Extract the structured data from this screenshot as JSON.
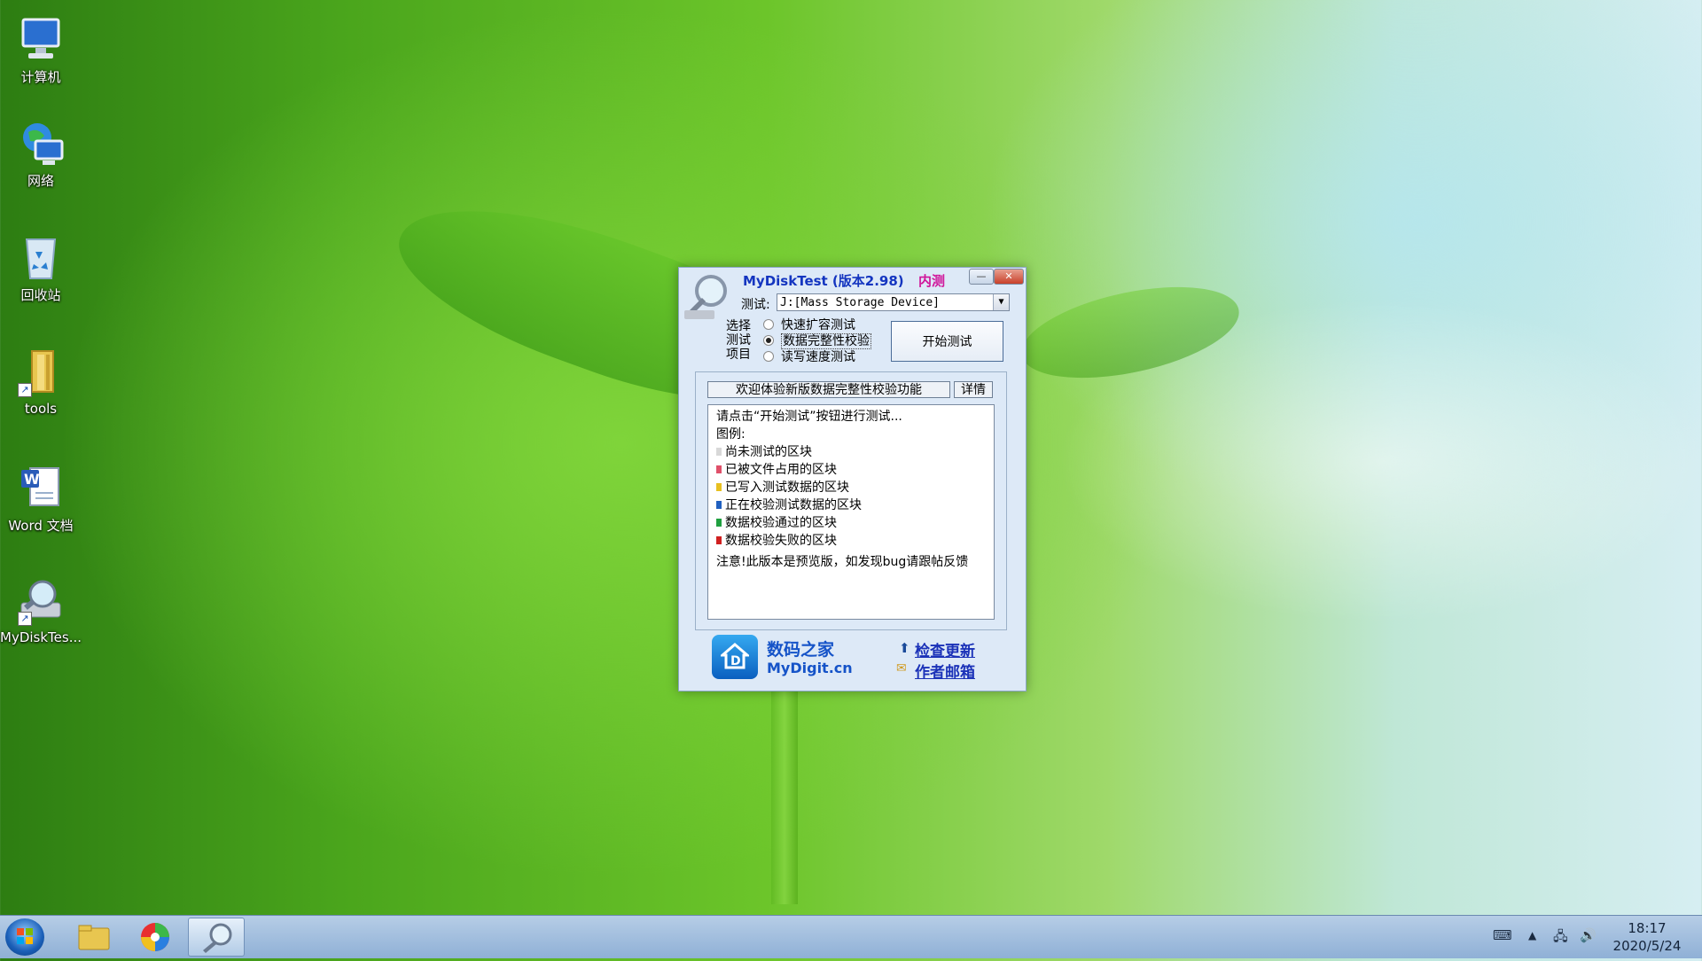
{
  "desktop": {
    "icons": [
      {
        "label": "计算机"
      },
      {
        "label": "网络"
      },
      {
        "label": "回收站"
      },
      {
        "label": "tools"
      },
      {
        "label": "Word 文档"
      },
      {
        "label": "MyDiskTes..."
      }
    ]
  },
  "dialog": {
    "title": "MyDiskTest (版本2.98)",
    "beta_label": "内测",
    "minimize": "—",
    "close": "✕",
    "test_label": "测试:",
    "device": "J:[Mass Storage Device]",
    "mode_label": "选择测试项目",
    "modes": [
      "快速扩容测试",
      "数据完整性校验",
      "读写速度测试"
    ],
    "selected_mode": "数据完整性校验",
    "start_button": "开始测试",
    "banner": "欢迎体验新版数据完整性校验功能",
    "detail_button": "详情",
    "instructions": "请点击“开始测试”按钮进行测试...",
    "legend_title": "图例:",
    "legend": [
      {
        "label": "尚未测试的区块",
        "color": "#d8d8d8"
      },
      {
        "label": "已被文件占用的区块",
        "color": "#e0506a"
      },
      {
        "label": "已写入测试数据的区块",
        "color": "#e8c020"
      },
      {
        "label": "正在校验测试数据的区块",
        "color": "#2060c0"
      },
      {
        "label": "数据校验通过的区块",
        "color": "#20a040"
      },
      {
        "label": "数据校验失败的区块",
        "color": "#d02020"
      }
    ],
    "notice": "注意!此版本是预览版，如发现bug请跟帖反馈",
    "brand_cn": "数码之家",
    "brand_en": "MyDigit.cn",
    "check_update": "检查更新",
    "author_email": "作者邮箱"
  },
  "taskbar": {
    "time": "18:17",
    "date": "2020/5/24"
  }
}
